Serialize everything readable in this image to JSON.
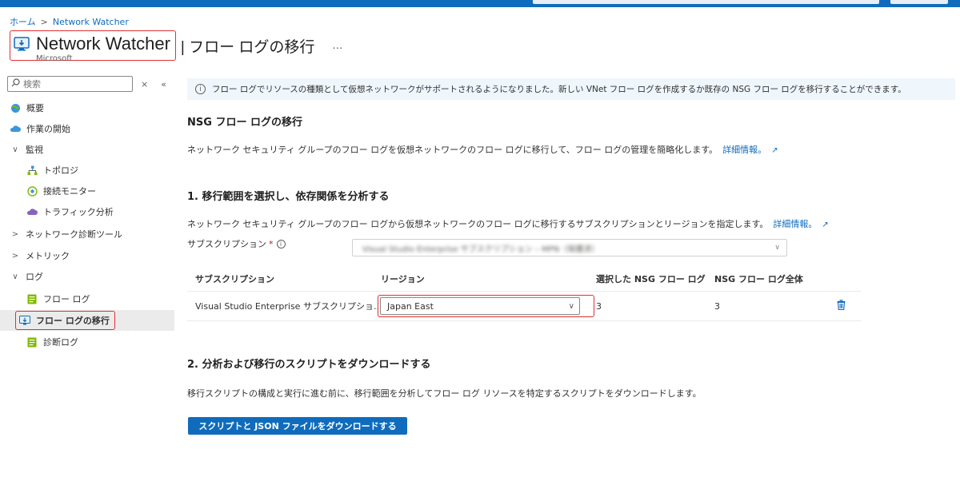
{
  "breadcrumb": {
    "home": "ホーム",
    "separator": ">",
    "current": "Network Watcher"
  },
  "header": {
    "app_title": "Network Watcher",
    "page_subtitle": "| フロー ログの移行",
    "more": "…",
    "provider": "Microsoft"
  },
  "sidebar": {
    "search_placeholder": "検索",
    "close_glyph": "×",
    "collapse_glyph": "«",
    "items": [
      {
        "label": "概要",
        "icon": "globe-icon"
      },
      {
        "label": "作業の開始",
        "icon": "cloud-icon"
      },
      {
        "label": "監視",
        "expander": "∨"
      },
      {
        "label": "トポロジ",
        "icon": "topology-icon"
      },
      {
        "label": "接続モニター",
        "icon": "connection-monitor-icon"
      },
      {
        "label": "トラフィック分析",
        "icon": "traffic-cloud-icon"
      },
      {
        "label": "ネットワーク診断ツール",
        "expander": ">"
      },
      {
        "label": "メトリック",
        "expander": ">"
      },
      {
        "label": "ログ",
        "expander": "∨"
      },
      {
        "label": "フロー ログ",
        "icon": "flow-log-icon"
      },
      {
        "label": "フロー ログの移行",
        "icon": "migrate-icon"
      },
      {
        "label": "診断ログ",
        "icon": "diagnostic-log-icon"
      }
    ]
  },
  "info_bar": {
    "icon": "info-icon",
    "text": "フロー ログでリソースの種類として仮想ネットワークがサポートされるようになりました。新しい VNet フロー ログを作成するか既存の NSG フロー ログを移行することができます。"
  },
  "main": {
    "heading": "NSG フロー ログの移行",
    "description": "ネットワーク セキュリティ グループのフロー ログを仮想ネットワークのフロー ログに移行して、フロー ログの管理を簡略化します。",
    "learn_more": "詳細情報。",
    "step1": {
      "heading": "1. 移行範囲を選択し、依存関係を分析する",
      "description": "ネットワーク セキュリティ グループのフロー ログから仮想ネットワークのフロー ログに移行するサブスクリプションとリージョンを指定します。",
      "learn_more": "詳細情報。",
      "subscription_label": "サブスクリプション",
      "required_mark": "*",
      "help_glyph": "i",
      "subscription_value": "Visual Studio Enterprise サブスクリプション – MPN（保護済）",
      "table": {
        "headers": [
          "サブスクリプション",
          "リージョン",
          "選択した NSG フロー ログ",
          "NSG フロー ログ全体"
        ],
        "rows": [
          {
            "subscription": "Visual Studio Enterprise サブスクリプショ...",
            "region": "Japan East",
            "selected": "3",
            "total": "3"
          }
        ]
      }
    },
    "step2": {
      "heading": "2. 分析および移行のスクリプトをダウンロードする",
      "description": "移行スクリプトの構成と実行に進む前に、移行範囲を分析してフロー ログ リソースを特定するスクリプトをダウンロードします。",
      "button": "スクリプトと JSON ファイルをダウンロードする"
    }
  },
  "colors": {
    "accent": "#0f6cbd",
    "highlight": "#e03030",
    "info_bg": "#eff6fc"
  }
}
